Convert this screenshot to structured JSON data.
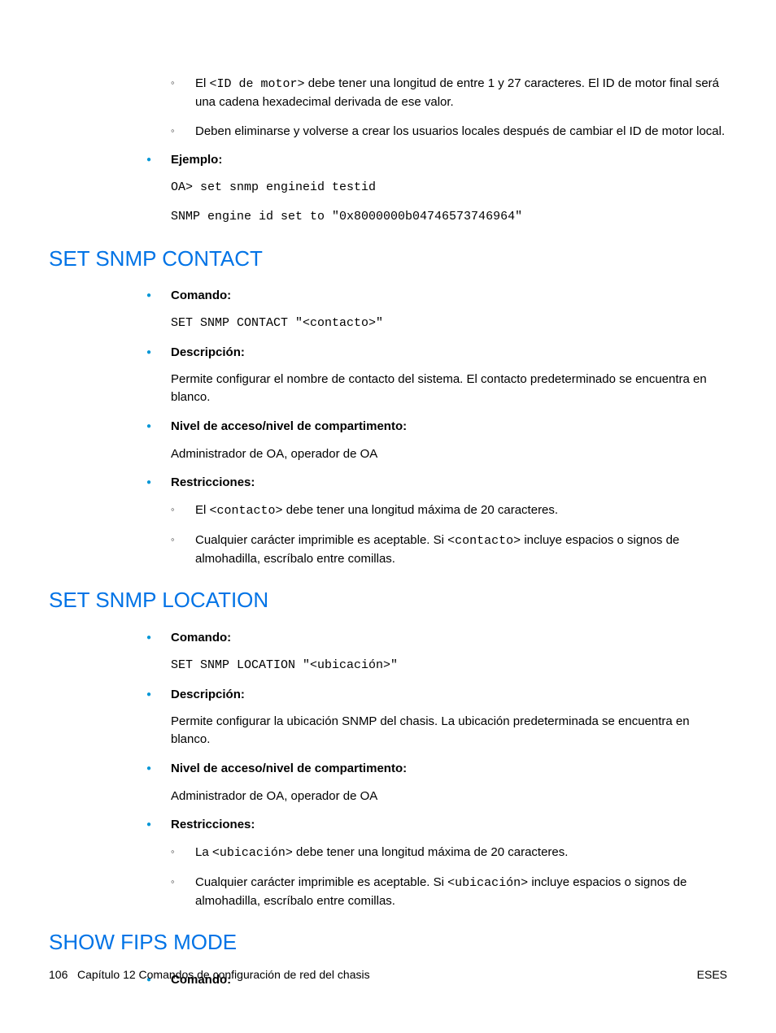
{
  "intro": {
    "sub1_prefix": "El ",
    "sub1_code": "<ID de motor>",
    "sub1_rest": " debe tener una longitud de entre 1 y 27 caracteres. El ID de motor final será una cadena hexadecimal derivada de ese valor.",
    "sub2": "Deben eliminarse y volverse a crear los usuarios locales después de cambiar el ID de motor local.",
    "ejemplo_label": "Ejemplo:",
    "ejemplo_line1": "OA> set snmp engineid testid",
    "ejemplo_line2": "SNMP engine id set to \"0x8000000b04746573746964\""
  },
  "contact": {
    "heading": "SET SNMP CONTACT",
    "comando_label": "Comando:",
    "comando_code": "SET SNMP CONTACT \"<contacto>\"",
    "desc_label": "Descripción:",
    "desc_text": "Permite configurar el nombre de contacto del sistema. El contacto predeterminado se encuentra en blanco.",
    "nivel_label": "Nivel de acceso/nivel de compartimento:",
    "nivel_text": "Administrador de OA, operador de OA",
    "restr_label": "Restricciones:",
    "restr1_prefix": "El ",
    "restr1_code": "<contacto>",
    "restr1_rest": " debe tener una longitud máxima de 20 caracteres.",
    "restr2_prefix": "Cualquier carácter imprimible es aceptable. Si ",
    "restr2_code": "<contacto>",
    "restr2_rest": " incluye espacios o signos de almohadilla, escríbalo entre comillas."
  },
  "location": {
    "heading": "SET SNMP LOCATION",
    "comando_label": "Comando:",
    "comando_code": "SET SNMP LOCATION \"<ubicación>\"",
    "desc_label": "Descripción:",
    "desc_text": "Permite configurar la ubicación SNMP del chasis. La ubicación predeterminada se encuentra en blanco.",
    "nivel_label": "Nivel de acceso/nivel de compartimento:",
    "nivel_text": "Administrador de OA, operador de OA",
    "restr_label": "Restricciones:",
    "restr1_prefix": "La ",
    "restr1_code": "<ubicación>",
    "restr1_rest": " debe tener una longitud máxima de 20 caracteres.",
    "restr2_prefix": "Cualquier carácter imprimible es aceptable. Si ",
    "restr2_code": "<ubicación>",
    "restr2_rest": " incluye espacios o signos de almohadilla, escríbalo entre comillas."
  },
  "fips": {
    "heading": "SHOW FIPS MODE",
    "comando_label": "Comando:"
  },
  "footer": {
    "page_num": "106",
    "chapter": "Capítulo 12   Comandos de configuración de red del chasis",
    "right": "ESES"
  }
}
